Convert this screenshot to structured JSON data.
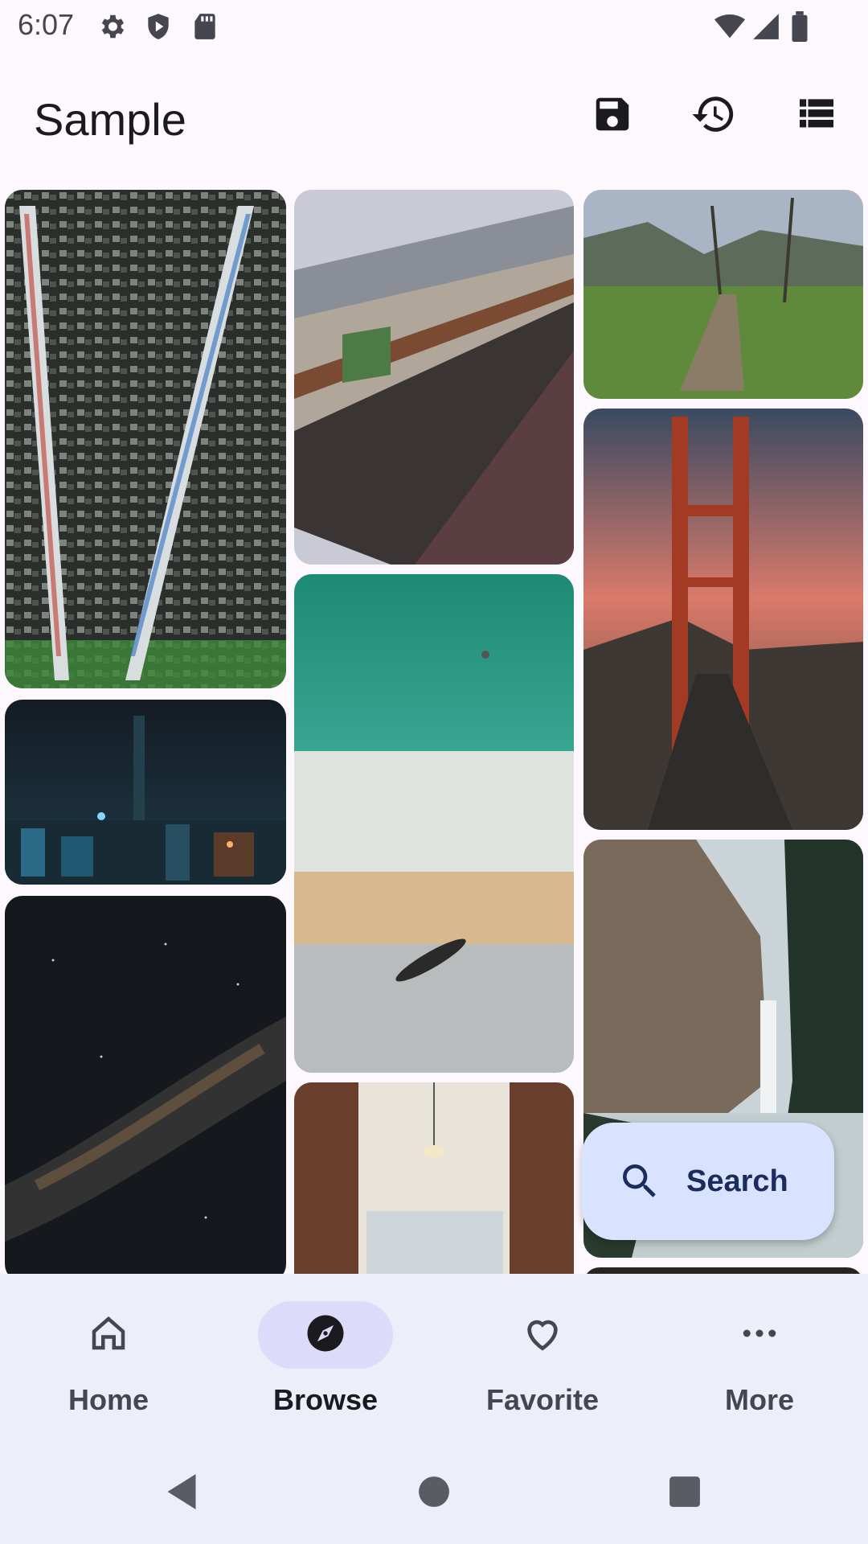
{
  "status_bar": {
    "time": "6:07",
    "icons": [
      "gear-icon",
      "shield-icon",
      "sd-card-icon",
      "wifi-icon",
      "cell-signal-icon",
      "battery-icon"
    ]
  },
  "app_bar": {
    "title": "Sample",
    "actions": [
      "save-icon",
      "history-icon",
      "view-list-icon"
    ]
  },
  "photos": [
    {
      "name": "photo-server-rack"
    },
    {
      "name": "photo-railway-platform"
    },
    {
      "name": "photo-countryside-path"
    },
    {
      "name": "photo-city-night"
    },
    {
      "name": "photo-beach-aerial"
    },
    {
      "name": "photo-golden-gate-bridge"
    },
    {
      "name": "photo-milky-way"
    },
    {
      "name": "photo-library"
    },
    {
      "name": "photo-waterfall"
    }
  ],
  "fab": {
    "label": "Search",
    "icon": "search-icon"
  },
  "bottom_nav": {
    "items": [
      {
        "label": "Home",
        "icon": "home-icon"
      },
      {
        "label": "Browse",
        "icon": "compass-icon",
        "active": true
      },
      {
        "label": "Favorite",
        "icon": "heart-icon"
      },
      {
        "label": "More",
        "icon": "more-horizontal-icon"
      }
    ]
  },
  "colors": {
    "background": "#fcf8fd",
    "nav_background": "#eceef9",
    "active_pill": "#dcdcfa",
    "fab_background": "#d9e2ff"
  }
}
